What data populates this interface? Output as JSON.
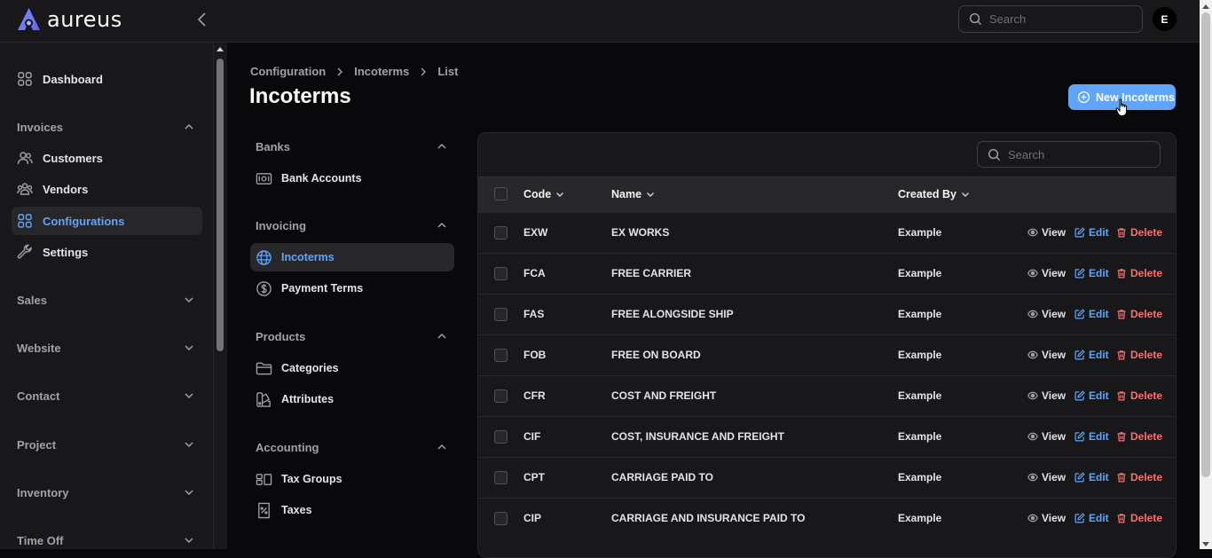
{
  "app": {
    "logo_text": "aureus",
    "avatar_initial": "E"
  },
  "header": {
    "search_placeholder": "Search"
  },
  "sidebar": {
    "items": [
      {
        "id": "dashboard",
        "label": "Dashboard",
        "icon": "grid-icon"
      },
      {
        "id": "invoices",
        "label": "Invoices",
        "type": "group",
        "expanded": true
      },
      {
        "id": "customers",
        "label": "Customers",
        "icon": "users-icon"
      },
      {
        "id": "vendors",
        "label": "Vendors",
        "icon": "user-group-icon"
      },
      {
        "id": "configurations",
        "label": "Configurations",
        "icon": "grid-icon",
        "active": true
      },
      {
        "id": "settings",
        "label": "Settings",
        "icon": "wrench-icon"
      },
      {
        "id": "sales",
        "label": "Sales",
        "type": "group",
        "expanded": false
      },
      {
        "id": "website",
        "label": "Website",
        "type": "group",
        "expanded": false
      },
      {
        "id": "contact",
        "label": "Contact",
        "type": "group",
        "expanded": false
      },
      {
        "id": "project",
        "label": "Project",
        "type": "group",
        "expanded": false
      },
      {
        "id": "inventory",
        "label": "Inventory",
        "type": "group",
        "expanded": false
      },
      {
        "id": "timeoff",
        "label": "Time Off",
        "type": "group",
        "expanded": false
      }
    ]
  },
  "breadcrumb": [
    "Configuration",
    "Incoterms",
    "List"
  ],
  "page": {
    "title": "Incoterms",
    "new_button": "New Incoterms"
  },
  "subnav": {
    "groups": [
      {
        "label": "Banks",
        "items": [
          {
            "label": "Bank Accounts",
            "icon": "bank-icon"
          }
        ]
      },
      {
        "label": "Invoicing",
        "items": [
          {
            "label": "Incoterms",
            "icon": "globe-icon",
            "active": true
          },
          {
            "label": "Payment Terms",
            "icon": "currency-icon"
          }
        ]
      },
      {
        "label": "Products",
        "items": [
          {
            "label": "Categories",
            "icon": "folder-icon"
          },
          {
            "label": "Attributes",
            "icon": "swatch-icon"
          }
        ]
      },
      {
        "label": "Accounting",
        "items": [
          {
            "label": "Tax Groups",
            "icon": "tax-group-icon"
          },
          {
            "label": "Taxes",
            "icon": "receipt-percent-icon"
          }
        ]
      }
    ]
  },
  "table": {
    "search_placeholder": "Search",
    "columns": [
      "Code",
      "Name",
      "Created By"
    ],
    "actions": {
      "view": "View",
      "edit": "Edit",
      "delete": "Delete"
    },
    "rows": [
      {
        "code": "EXW",
        "name": "EX WORKS",
        "created_by": "Example"
      },
      {
        "code": "FCA",
        "name": "FREE CARRIER",
        "created_by": "Example"
      },
      {
        "code": "FAS",
        "name": "FREE ALONGSIDE SHIP",
        "created_by": "Example"
      },
      {
        "code": "FOB",
        "name": "FREE ON BOARD",
        "created_by": "Example"
      },
      {
        "code": "CFR",
        "name": "COST AND FREIGHT",
        "created_by": "Example"
      },
      {
        "code": "CIF",
        "name": "COST, INSURANCE AND FREIGHT",
        "created_by": "Example"
      },
      {
        "code": "CPT",
        "name": "CARRIAGE PAID TO",
        "created_by": "Example"
      },
      {
        "code": "CIP",
        "name": "CARRIAGE AND INSURANCE PAID TO",
        "created_by": "Example"
      }
    ]
  },
  "colors": {
    "accent": "#60a5fa",
    "danger": "#f87171",
    "background": "#09090b",
    "panel": "#18181b"
  }
}
